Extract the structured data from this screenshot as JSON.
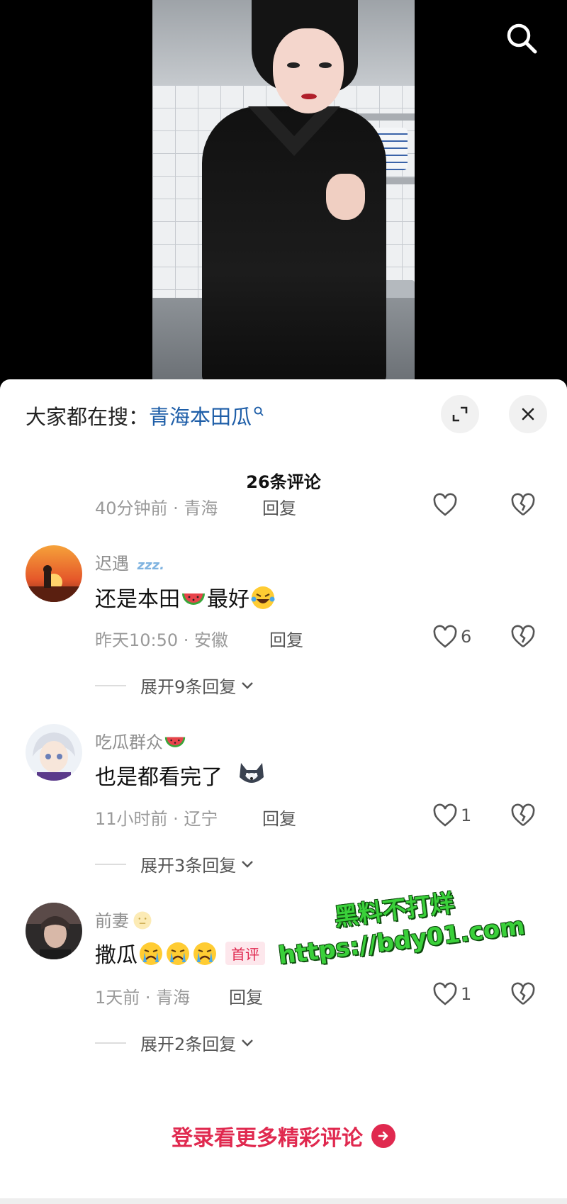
{
  "search_hint": {
    "prefix": "大家都在搜：",
    "keyword": "青海本田瓜"
  },
  "comments_header": {
    "count_label": "26条评论"
  },
  "partial_comment": {
    "time_location": "40分钟前 · 青海",
    "reply_label": "回复"
  },
  "comments": [
    {
      "username": "迟遇",
      "username_icon": "sleeping-zzz-icon",
      "text_before": "还是本田",
      "emoji_1": "watermelon-emoji",
      "text_after": "最好",
      "emoji_2": "laughing-tears-emoji",
      "time_location": "昨天10:50 · 安徽",
      "reply_label": "回复",
      "likes": "6",
      "expand_label": "展开9条回复"
    },
    {
      "username": "吃瓜群众",
      "username_icon": "watermelon-emoji",
      "text": "也是都看完了",
      "emoji_1": "husky-dog-emoji",
      "time_location": "11小时前 · 辽宁",
      "reply_label": "回复",
      "likes": "1",
      "expand_label": "展开3条回复"
    },
    {
      "username": "前妻",
      "username_icon": "neutral-face-emoji",
      "text": "撒瓜",
      "emoji_1": "crying-emoji",
      "badge": "首评",
      "time_location": "1天前 · 青海",
      "reply_label": "回复",
      "likes": "1",
      "expand_label": "展开2条回复"
    }
  ],
  "watermark": {
    "line1": "黑料不打烊",
    "line2": "https://bdy01.com"
  },
  "login_more": {
    "label": "登录看更多精彩评论"
  },
  "colors": {
    "accent_pink": "#e0294f",
    "keyword_blue": "#1e5ea8",
    "watermark_green": "#3ad03a"
  }
}
